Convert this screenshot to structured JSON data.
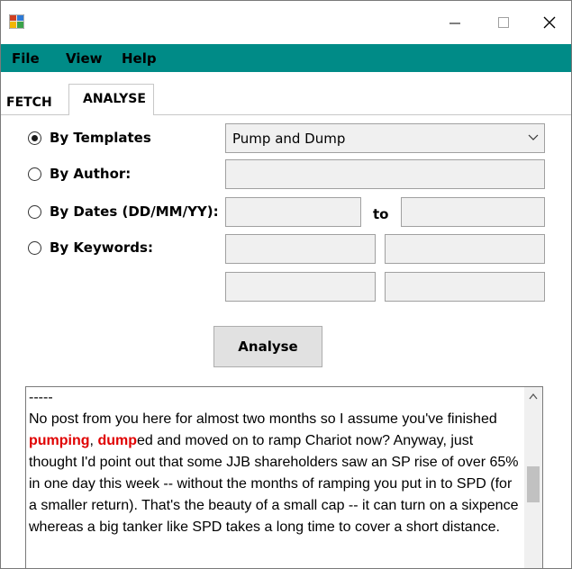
{
  "window": {
    "app_icon": "windows-forms-app-icon",
    "title": ""
  },
  "window_controls": {
    "minimize": "—",
    "maximize": "☐",
    "close": "✕"
  },
  "menu": {
    "items": [
      "File",
      "View",
      "Help"
    ]
  },
  "tabs": [
    {
      "label": "FETCH",
      "active": false
    },
    {
      "label": "ANALYSE",
      "active": true
    }
  ],
  "options": {
    "by_templates": {
      "label": "By Templates",
      "checked": true
    },
    "by_author": {
      "label": "By Author:",
      "checked": false
    },
    "by_dates": {
      "label": "By Dates (DD/MM/YY):",
      "checked": false
    },
    "by_keywords": {
      "label": "By Keywords:",
      "checked": false
    }
  },
  "template_select": {
    "value": "Pump and Dump"
  },
  "author_input": {
    "value": ""
  },
  "date_from": {
    "value": ""
  },
  "date_to_label": "to",
  "date_to": {
    "value": ""
  },
  "keywords": [
    "",
    "",
    "",
    ""
  ],
  "analyse_button": {
    "label": "Analyse"
  },
  "results": {
    "separator": "-----",
    "segments": [
      {
        "text": " No post from you here for almost two months so I assume you've finished ",
        "highlight": false
      },
      {
        "text": "pumping",
        "highlight": true
      },
      {
        "text": ", ",
        "highlight": false
      },
      {
        "text": "dump",
        "highlight": true
      },
      {
        "text": "ed and moved on to ramp Chariot now? Anyway, just thought I'd point out that some JJB shareholders saw an SP rise of over 65% in one day this week -- without the months of ramping you put in to SPD (for a smaller return). That's the beauty of a small cap -- it can turn on a sixpence whereas a big tanker like SPD takes a long time to cover a short distance.",
        "highlight": false
      }
    ]
  },
  "colors": {
    "menubar": "#008b87",
    "highlight": "#e00000"
  }
}
